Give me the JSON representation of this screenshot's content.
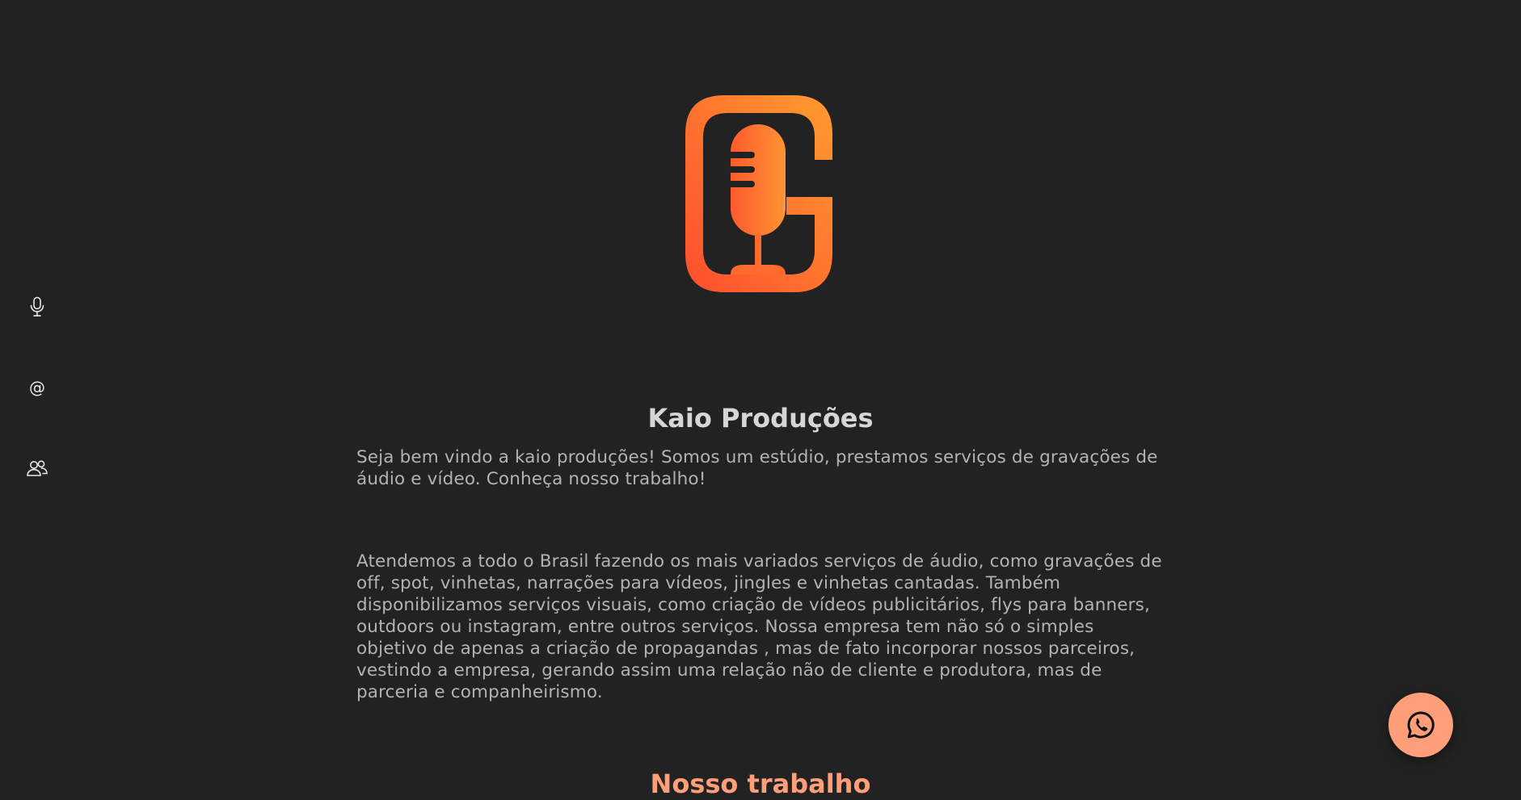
{
  "side_nav": {
    "items": [
      {
        "icon": "microphone-icon"
      },
      {
        "icon": "at-sign-icon",
        "glyph": "@"
      },
      {
        "icon": "users-icon"
      }
    ]
  },
  "logo": {
    "icon": "kaio-producoes-logo"
  },
  "main": {
    "title": "Kaio Produções",
    "intro": "Seja bem vindo a kaio produções! Somos um estúdio, prestamos serviços de gravações de áudio e vídeo. Conheça nosso trabalho!",
    "about": "Atendemos a todo o Brasil fazendo os mais variados serviços de áudio, como gravações de off, spot, vinhetas, narrações para vídeos, jingles e vinhetas cantadas. Também disponibilizamos serviços visuais, como criação de vídeos publicitários, flys para banners, outdoors ou instagram, entre outros serviços. Nossa empresa tem não só o simples objetivo de apenas a criação de propagandas , mas de fato incorporar nossos parceiros, vestindo a empresa, gerando assim uma relação não de cliente e produtora, mas de parceria e companheirismo."
  },
  "work_section": {
    "title": "Nosso trabalho"
  },
  "whatsapp_button": {
    "icon": "whatsapp-icon"
  },
  "colors": {
    "background": "#222222",
    "accent": "#ff9f7a",
    "logo_orange": "#ff8c2a",
    "logo_red": "#ff5a2d",
    "text": "#b3b3b3",
    "title": "#d6d6d6"
  }
}
